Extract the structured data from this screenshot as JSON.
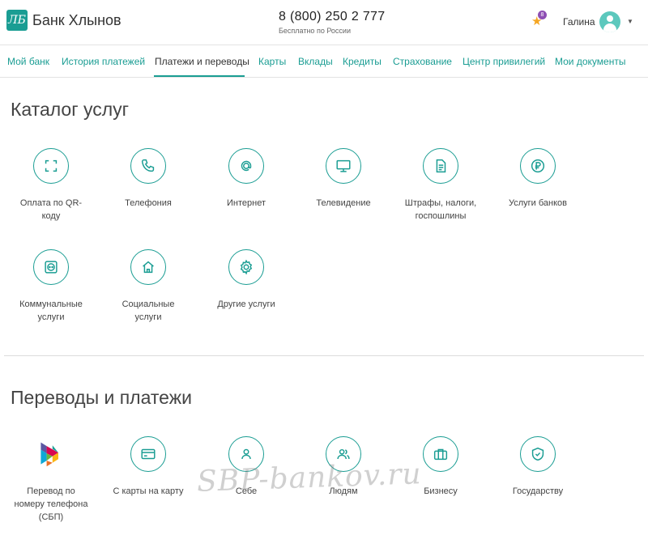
{
  "header": {
    "logo_text": "Банк Хлынов",
    "phone": "8 (800) 250 2 777",
    "phone_note": "Бесплатно по России",
    "notifications_count": "8",
    "user_name": "Галина"
  },
  "nav": {
    "items": [
      {
        "label": "Мой банк"
      },
      {
        "label": "История платежей"
      },
      {
        "label": "Платежи и переводы"
      },
      {
        "label": "Карты"
      },
      {
        "label": "Вклады"
      },
      {
        "label": "Кредиты"
      },
      {
        "label": "Страхование"
      },
      {
        "label": "Центр привилегий"
      },
      {
        "label": "Мои документы"
      }
    ],
    "active_index": 2
  },
  "catalog": {
    "title": "Каталог услуг",
    "items": [
      {
        "label": "Оплата по QR-\nкоду",
        "icon": "qr-scan-icon"
      },
      {
        "label": "Телефония",
        "icon": "phone-icon"
      },
      {
        "label": "Интернет",
        "icon": "at-icon"
      },
      {
        "label": "Телевидение",
        "icon": "tv-icon"
      },
      {
        "label": "Штрафы, налоги,\nгоспошлины",
        "icon": "document-icon"
      },
      {
        "label": "Услуги банков",
        "icon": "ruble-icon"
      },
      {
        "label": "Коммунальные\nуслуги",
        "icon": "socket-icon"
      },
      {
        "label": "Социальные\nуслуги",
        "icon": "house-icon"
      },
      {
        "label": "Другие услуги",
        "icon": "gear-icon"
      }
    ]
  },
  "transfers": {
    "title": "Переводы и платежи",
    "items": [
      {
        "label": "Перевод по\nномеру телефона\n(СБП)",
        "icon": "sbp-logo-icon"
      },
      {
        "label": "С карты на карту",
        "icon": "card-icon"
      },
      {
        "label": "Себе",
        "icon": "person-icon"
      },
      {
        "label": "Людям",
        "icon": "people-icon"
      },
      {
        "label": "Бизнесу",
        "icon": "briefcase-icon"
      },
      {
        "label": "Государству",
        "icon": "shield-icon"
      }
    ]
  },
  "watermark": "SBP-bankov.ru",
  "colors": {
    "accent": "#1a9d93",
    "badge": "#8e4fb3",
    "star": "#f5a623"
  }
}
